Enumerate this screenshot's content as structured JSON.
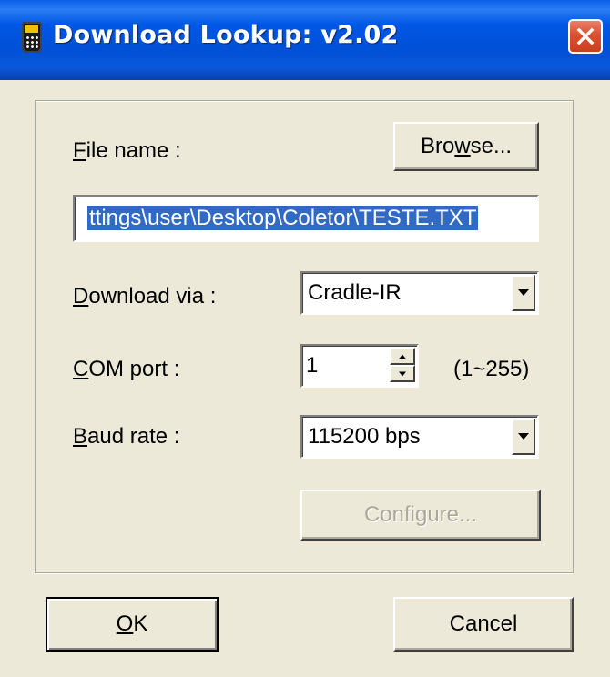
{
  "window": {
    "title": "Download Lookup: v2.02"
  },
  "form": {
    "file_name_label": {
      "accel": "F",
      "rest": "ile name :"
    },
    "browse_button": {
      "pre": "Bro",
      "accel": "w",
      "post": "se..."
    },
    "file_path_value": "ttings\\user\\Desktop\\Coletor\\TESTE.TXT",
    "download_via_label": {
      "accel": "D",
      "rest": "ownload via :"
    },
    "download_via_value": "Cradle-IR",
    "com_port_label": {
      "accel": "C",
      "rest": "OM port :"
    },
    "com_port_value": "1",
    "com_port_range": "(1~255)",
    "baud_rate_label": {
      "accel": "B",
      "rest": "aud rate :"
    },
    "baud_rate_value": "115200 bps",
    "configure_button": "Configure..."
  },
  "footer": {
    "ok_button": {
      "accel": "O",
      "rest": "K"
    },
    "cancel_button": "Cancel"
  },
  "colors": {
    "title_bar": "#0054E3",
    "face": "#ECE9D8",
    "selection": "#316AC5",
    "close_button": "#D8502E",
    "disabled_text": "#ACA899"
  },
  "icons": [
    "app-icon",
    "close-icon",
    "dropdown-arrow-icon",
    "spin-up-icon",
    "spin-down-icon"
  ]
}
